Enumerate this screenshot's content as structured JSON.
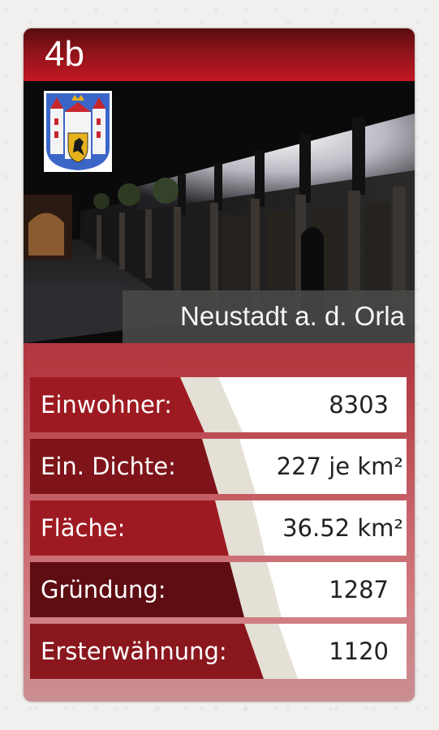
{
  "card": {
    "number": "4b",
    "city": "Neustadt a. d. Orla",
    "crest_icon": "coat-of-arms-icon",
    "photo": "night-street-half-timbered-houses-image",
    "colors": {
      "header_red": "#c21822",
      "card_red": "#9e1a22",
      "label_bg": "#484848"
    }
  },
  "stats": [
    {
      "label": "Einwohner:",
      "value": "8303"
    },
    {
      "label": "Ein. Dichte:",
      "value": "227 je km²"
    },
    {
      "label": "Fläche:",
      "value": "36.52 km²"
    },
    {
      "label": "Gründung:",
      "value": "1287"
    },
    {
      "label": "Ersterwähnung:",
      "value": "1120"
    }
  ]
}
